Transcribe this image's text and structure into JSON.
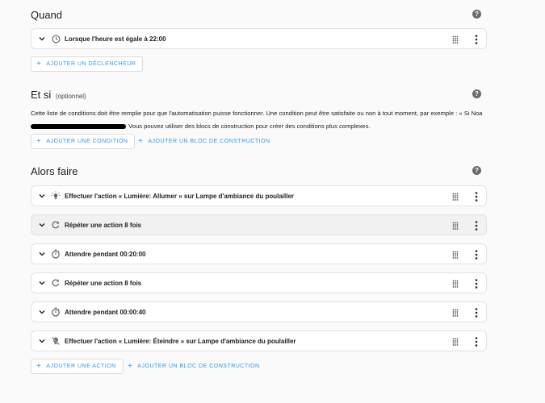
{
  "when": {
    "title": "Quand",
    "help_icon": "?",
    "triggers": [
      {
        "label": "Lorsque l'heure est égale à 22:00",
        "icon": "clock-icon"
      }
    ],
    "add_button": "AJOUTER UN DÉCLENCHEUR"
  },
  "conditions": {
    "title": "Et si",
    "optional": "(optionnel)",
    "help_icon": "?",
    "description_line1": "Cette liste de conditions doit être remplie pour que l'automatisation puisse fonctionner. Une condition peut être satisfaite ou non à tout moment, par exemple : « Si Noa",
    "description_line2": " Vous pouvez utiliser des blocs de construction pour créer des conditions plus complexes.",
    "add_button": "AJOUTER UNE CONDITION",
    "add_block_button": "AJOUTER UN BLOC DE CONSTRUCTION"
  },
  "actions": {
    "title": "Alors faire",
    "help_icon": "?",
    "items": [
      {
        "label": "Effectuer l'action « Lumière: Allumer » sur Lampe d'ambiance du poulailler",
        "icon": "lightbulb-on-icon"
      },
      {
        "label": "Répéter une action 8 fois",
        "icon": "refresh-icon"
      },
      {
        "label": "Attendre pendant 00:20:00",
        "icon": "timer-icon"
      },
      {
        "label": "Répéter une action 8 fois",
        "icon": "refresh-icon"
      },
      {
        "label": "Attendre pendant 00:00:40",
        "icon": "timer-icon"
      },
      {
        "label": "Effectuer l'action « Lumière: Éteindre » sur Lampe d'ambiance du poulailler",
        "icon": "lightbulb-off-icon"
      }
    ],
    "add_button": "AJOUTER UNE ACTION",
    "add_block_button": "AJOUTER UN BLOC DE CONSTRUCTION"
  },
  "colors": {
    "accent": "#2b9af3",
    "icon_grey": "#616161",
    "card_border": "#e2e2e2",
    "background": "#fafafa"
  }
}
